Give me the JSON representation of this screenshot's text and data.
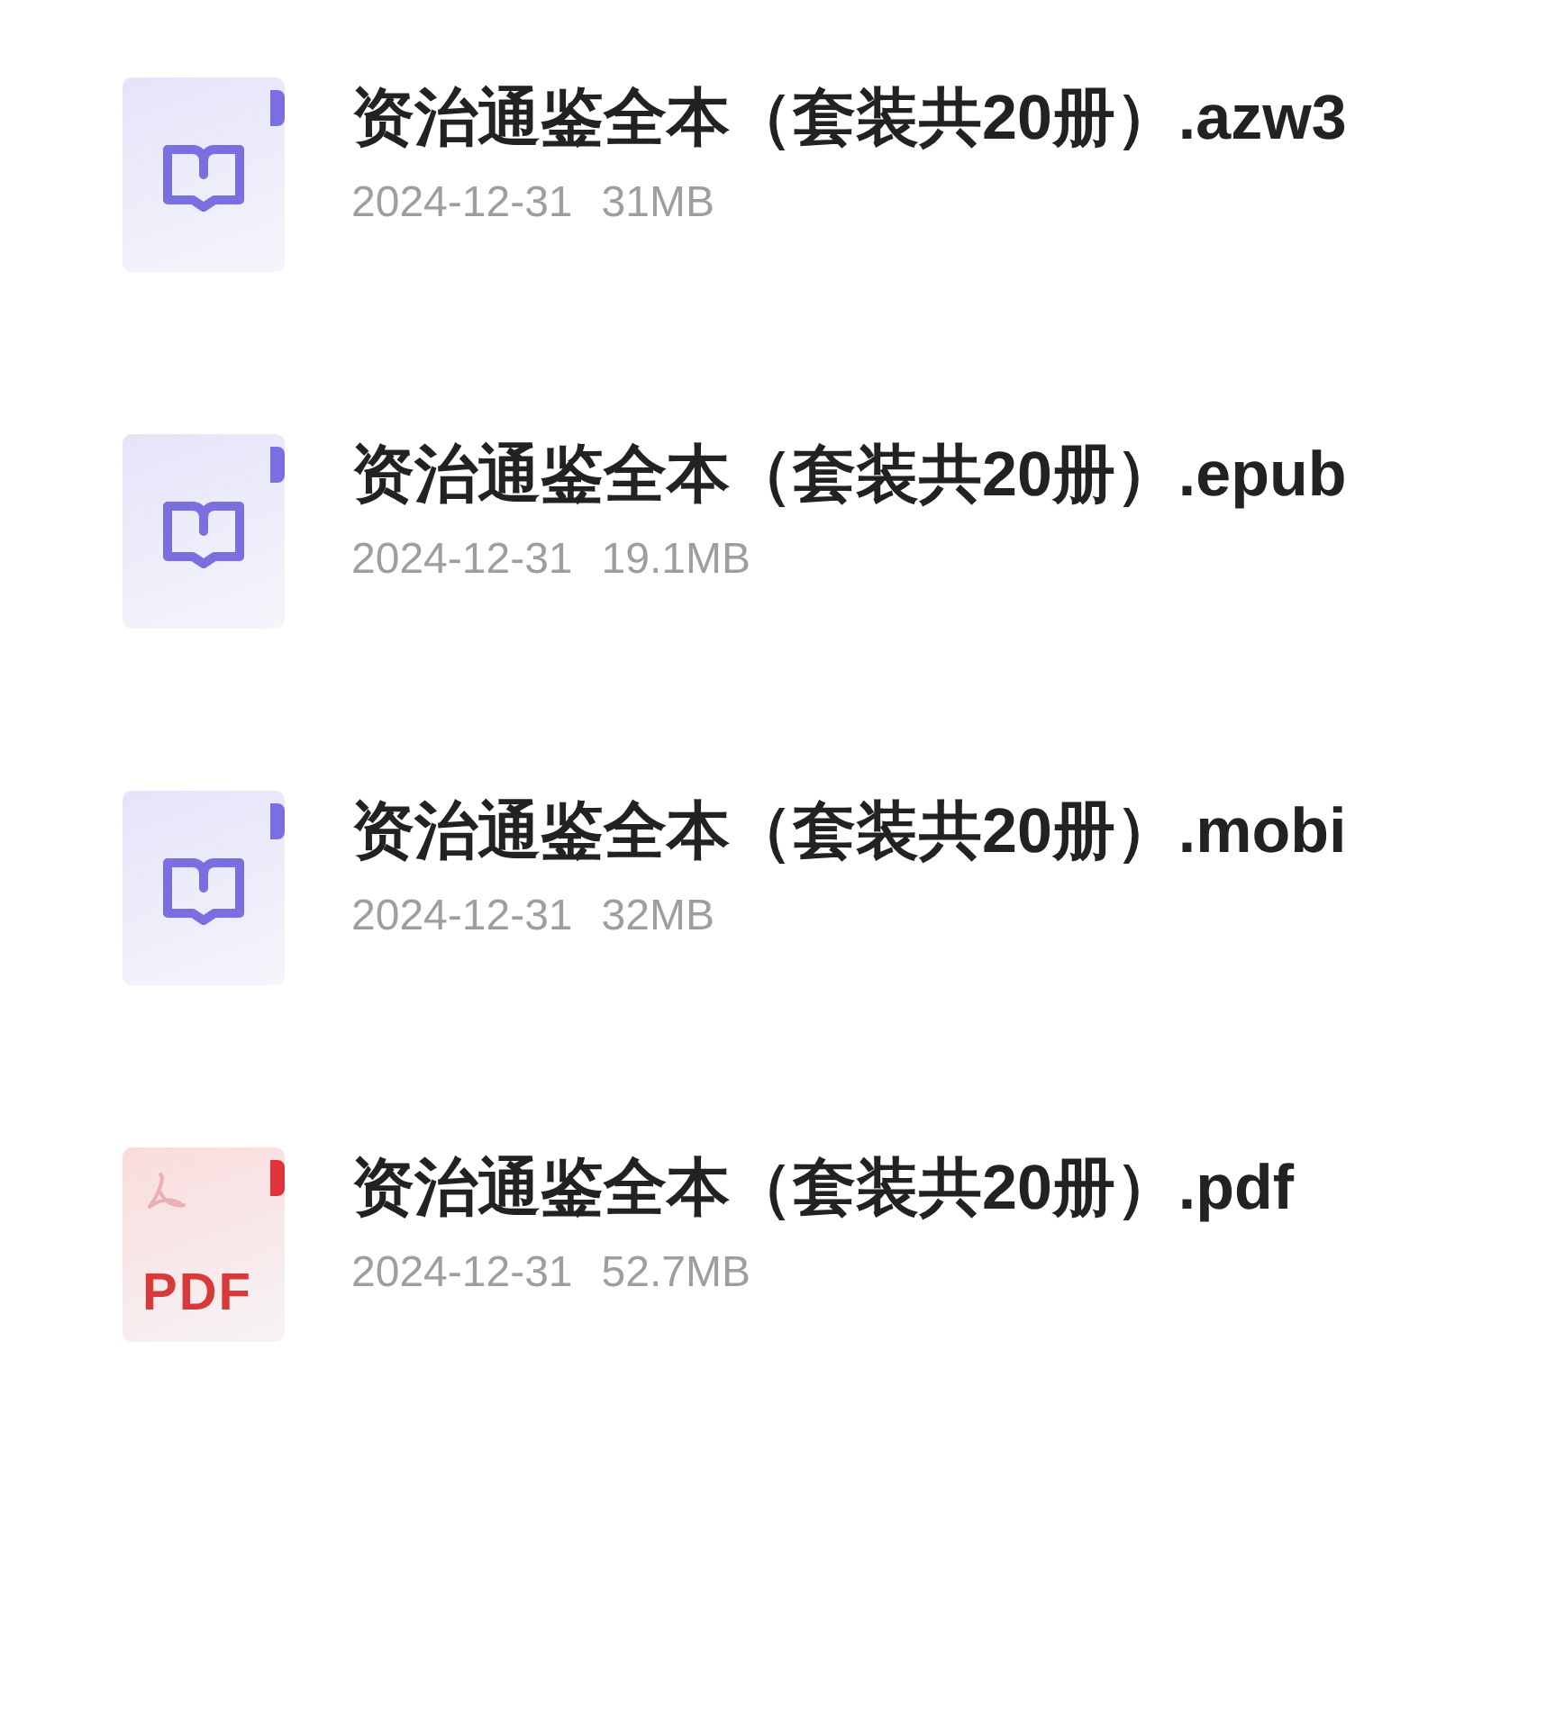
{
  "files": [
    {
      "kind": "ebook",
      "name": "资治通鉴全本（套装共20册）.azw3",
      "date": "2024-12-31",
      "size": "31MB"
    },
    {
      "kind": "ebook",
      "name": "资治通鉴全本（套装共20册）.epub",
      "date": "2024-12-31",
      "size": "19.1MB"
    },
    {
      "kind": "ebook",
      "name": "资治通鉴全本（套装共20册）.mobi",
      "date": "2024-12-31",
      "size": "32MB"
    },
    {
      "kind": "pdf",
      "icon_label": "PDF",
      "name": "资治通鉴全本（套装共20册）.pdf",
      "date": "2024-12-31",
      "size": "52.7MB"
    }
  ]
}
